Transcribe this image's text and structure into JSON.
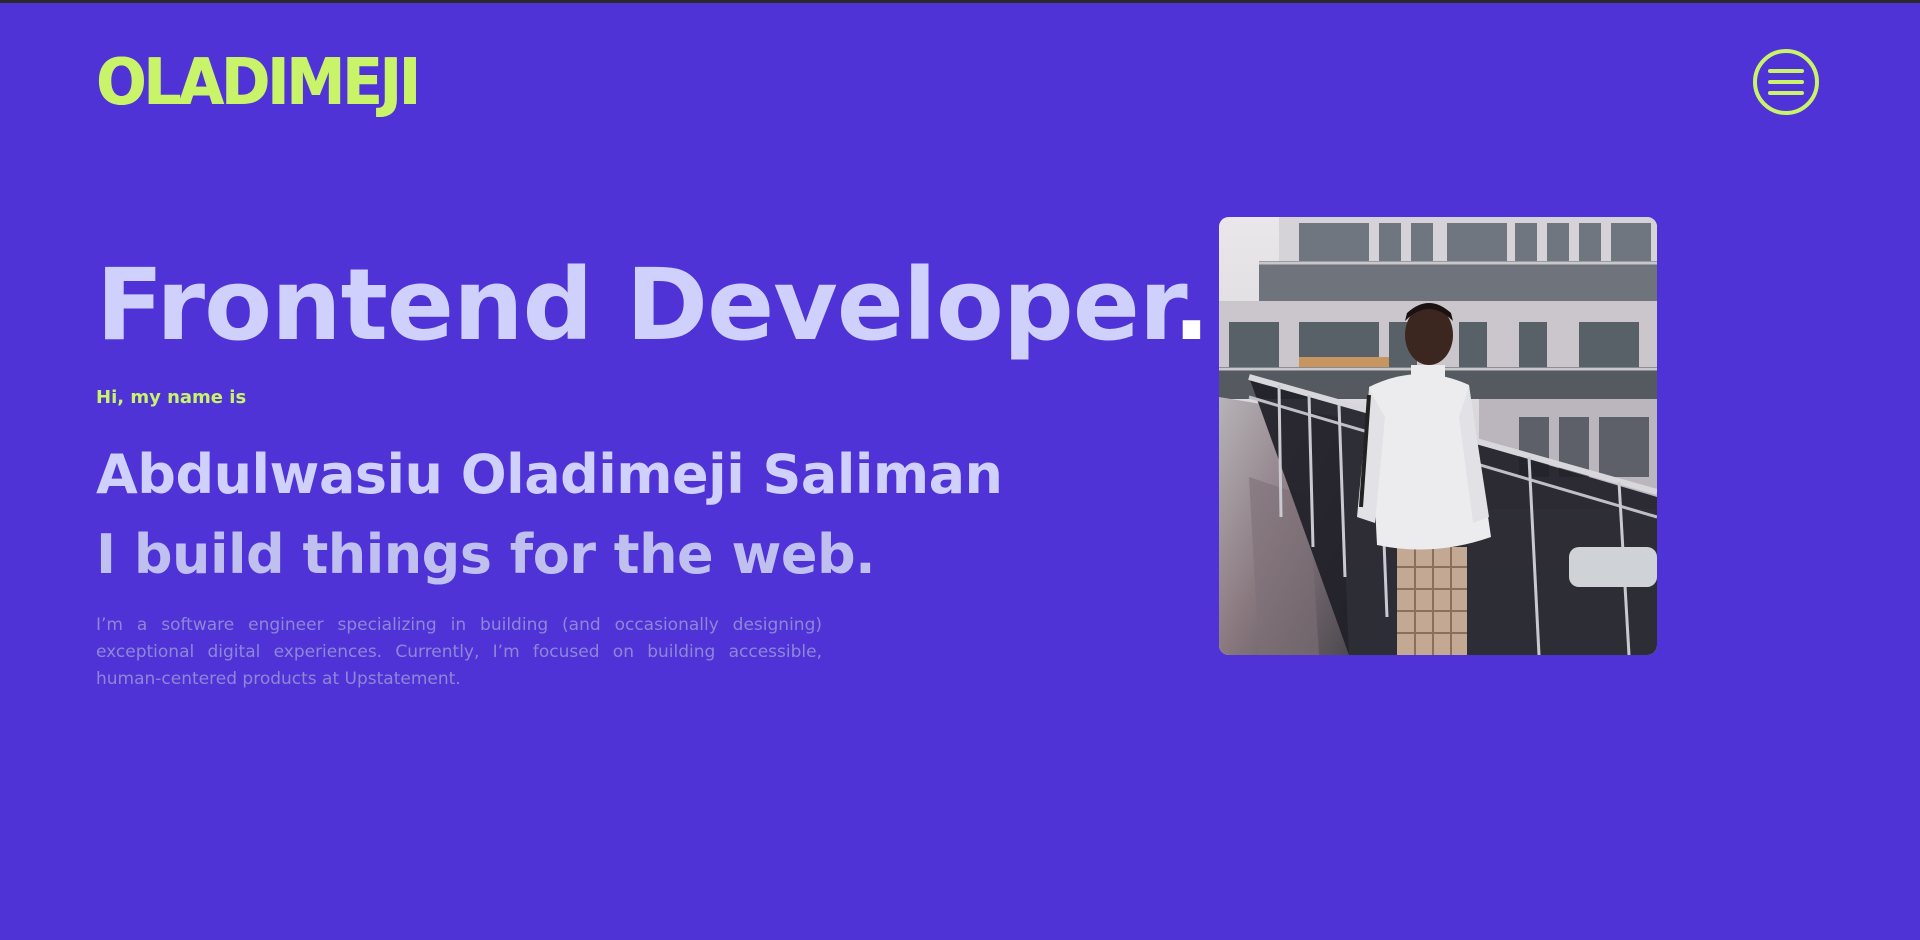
{
  "header": {
    "logo_text": "OLADIMEJI",
    "menu_icon": "hamburger-menu-icon"
  },
  "hero": {
    "title": "Frontend Developer",
    "title_dot": ".",
    "greeting": "Hi, my name is",
    "name": "Abdulwasiu Oladimeji Saliman",
    "tagline": "I build things for the web.",
    "intro": "I’m a software engineer specializing in building (and occasionally designing) exceptional digital experiences. Currently, I’m focused on building accessible, human-centered products at Upstatement."
  },
  "colors": {
    "background": "#4f33d6",
    "accent": "#c9f46a",
    "heading": "#cfd0fb",
    "body_text": "#8f86d8"
  }
}
